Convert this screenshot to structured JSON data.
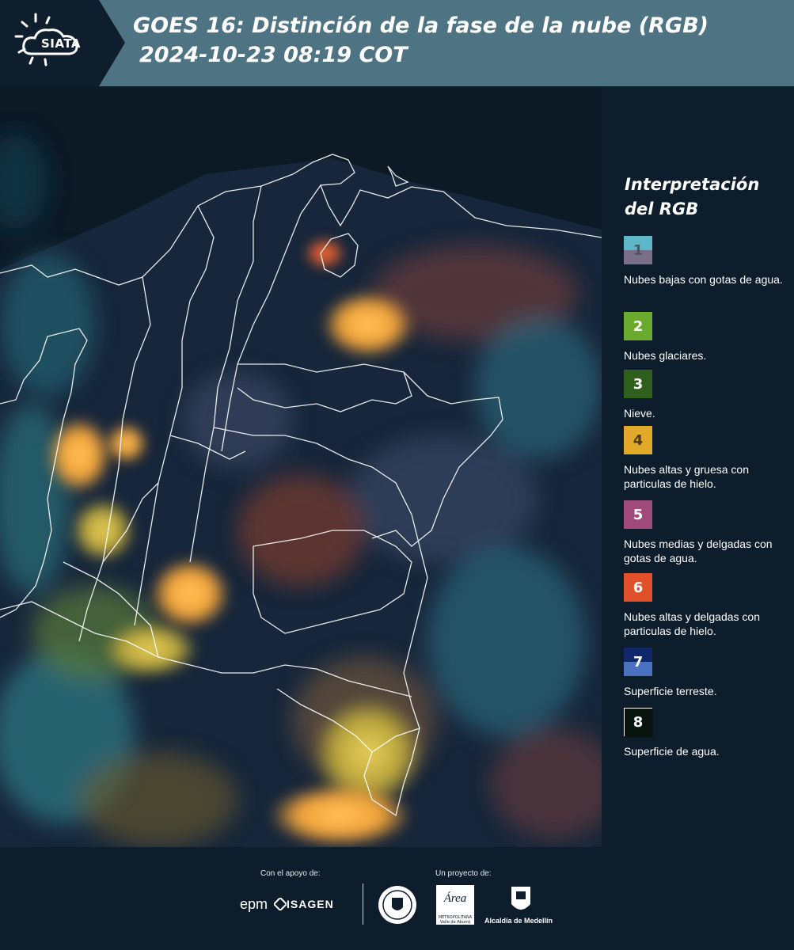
{
  "header": {
    "logo_text": "SIATA",
    "title_line1": "GOES 16: Distinción de la fase de la nube (RGB)",
    "title_line2": "2024-10-23 08:19 COT",
    "header_color": "#4e7484"
  },
  "map": {
    "background_color": "#0d1a26",
    "boundary_color": "#ffffff"
  },
  "legend": {
    "title": "Interpretación del RGB",
    "items": [
      {
        "number": "1",
        "label": "Nubes bajas con gotas de agua.",
        "color_top": "#5eb7c8",
        "color_bottom": "#7a6f8a"
      },
      {
        "number": "2",
        "label": "Nubes glaciares.",
        "color_top": "#6aaa2e",
        "color_bottom": "#6aaa2e"
      },
      {
        "number": "3",
        "label": "Nieve.",
        "color_top": "#2e5f1c",
        "color_bottom": "#2e5f1c"
      },
      {
        "number": "4",
        "label": "Nubes altas y gruesa con particulas de hielo.",
        "color_top": "#e0a92a",
        "color_bottom": "#e0a92a"
      },
      {
        "number": "5",
        "label": "Nubes medias y delgadas con gotas de agua.",
        "color_top": "#a04a7c",
        "color_bottom": "#a04a7c"
      },
      {
        "number": "6",
        "label": "Nubes altas y delgadas con particulas de hielo.",
        "color_top": "#e0502a",
        "color_bottom": "#e0502a"
      },
      {
        "number": "7",
        "label": "Superficie terreste.",
        "color_top": "#10286a",
        "color_bottom": "#4a72c0"
      },
      {
        "number": "8",
        "label": "Superficie de agua.",
        "color_top": "#0a140e",
        "color_bottom": "#0a140e"
      }
    ]
  },
  "footer": {
    "support_label": "Con el apoyo de:",
    "project_label": "Un proyecto de:",
    "epm": "epm",
    "isagen": "ISAGEN",
    "area": "Área",
    "area_sub": "METROPOLITANA Valle de Aburrá",
    "alcaldia": "Alcaldía de Medellín"
  }
}
